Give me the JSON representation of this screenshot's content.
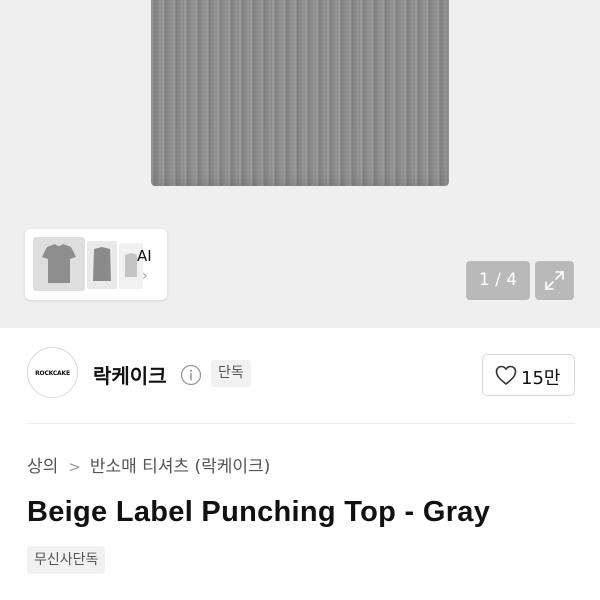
{
  "gallery": {
    "ai_label": "AI",
    "counter": "1 / 4",
    "icons": {
      "expand": "expand-arrows-icon",
      "chevron": "chevron-right-icon"
    }
  },
  "brand": {
    "logo_text": "ROCKCAKE",
    "name": "락케이크",
    "badge": "단독",
    "like_count": "15만",
    "icons": {
      "info": "info-icon",
      "like": "heart-icon"
    }
  },
  "breadcrumb": {
    "items": [
      "상의",
      "반소매 티셔츠 (락케이크)"
    ],
    "separator": ">"
  },
  "product": {
    "title": "Beige Label Punching Top - Gray",
    "tags": [
      "무신사단독"
    ]
  },
  "colors": {
    "garment_gray": "#8f8f8f",
    "hero_background": "#efefef",
    "overlay_button": "#8c8c8c"
  }
}
